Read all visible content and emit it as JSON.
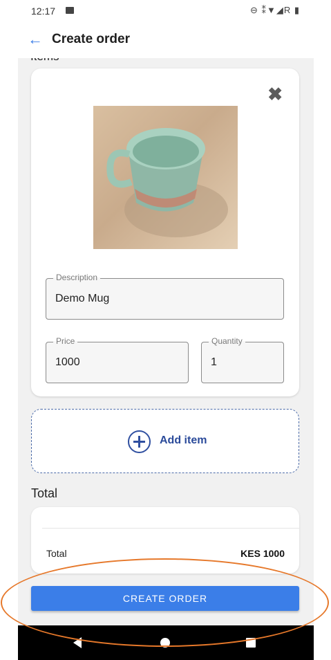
{
  "status_bar": {
    "time": "12:17",
    "icons": [
      "image-icon",
      "dnd-icon",
      "wifi-icon",
      "signal-icon",
      "battery-icon"
    ],
    "right_text": "⊖ ⁑▼◢R ▮"
  },
  "app_bar": {
    "title": "Create order",
    "back_icon": "arrow-left-icon"
  },
  "items_section": {
    "label": "Items"
  },
  "item": {
    "image_alt": "Demo mug photo",
    "description": {
      "label": "Description",
      "value": "Demo Mug"
    },
    "price": {
      "label": "Price",
      "value": "1000"
    },
    "quantity": {
      "label": "Quantity",
      "value": "1"
    }
  },
  "add_item": {
    "label": "Add item",
    "icon": "plus-circle-icon"
  },
  "total_section": {
    "heading": "Total",
    "label": "Total",
    "value": "KES 1000"
  },
  "create_button": {
    "label": "CREATE ORDER"
  },
  "colors": {
    "accent": "#3b7ee8",
    "add_item": "#2a4a9a",
    "annotation": "#e6782a",
    "background": "#f1f1f1"
  }
}
